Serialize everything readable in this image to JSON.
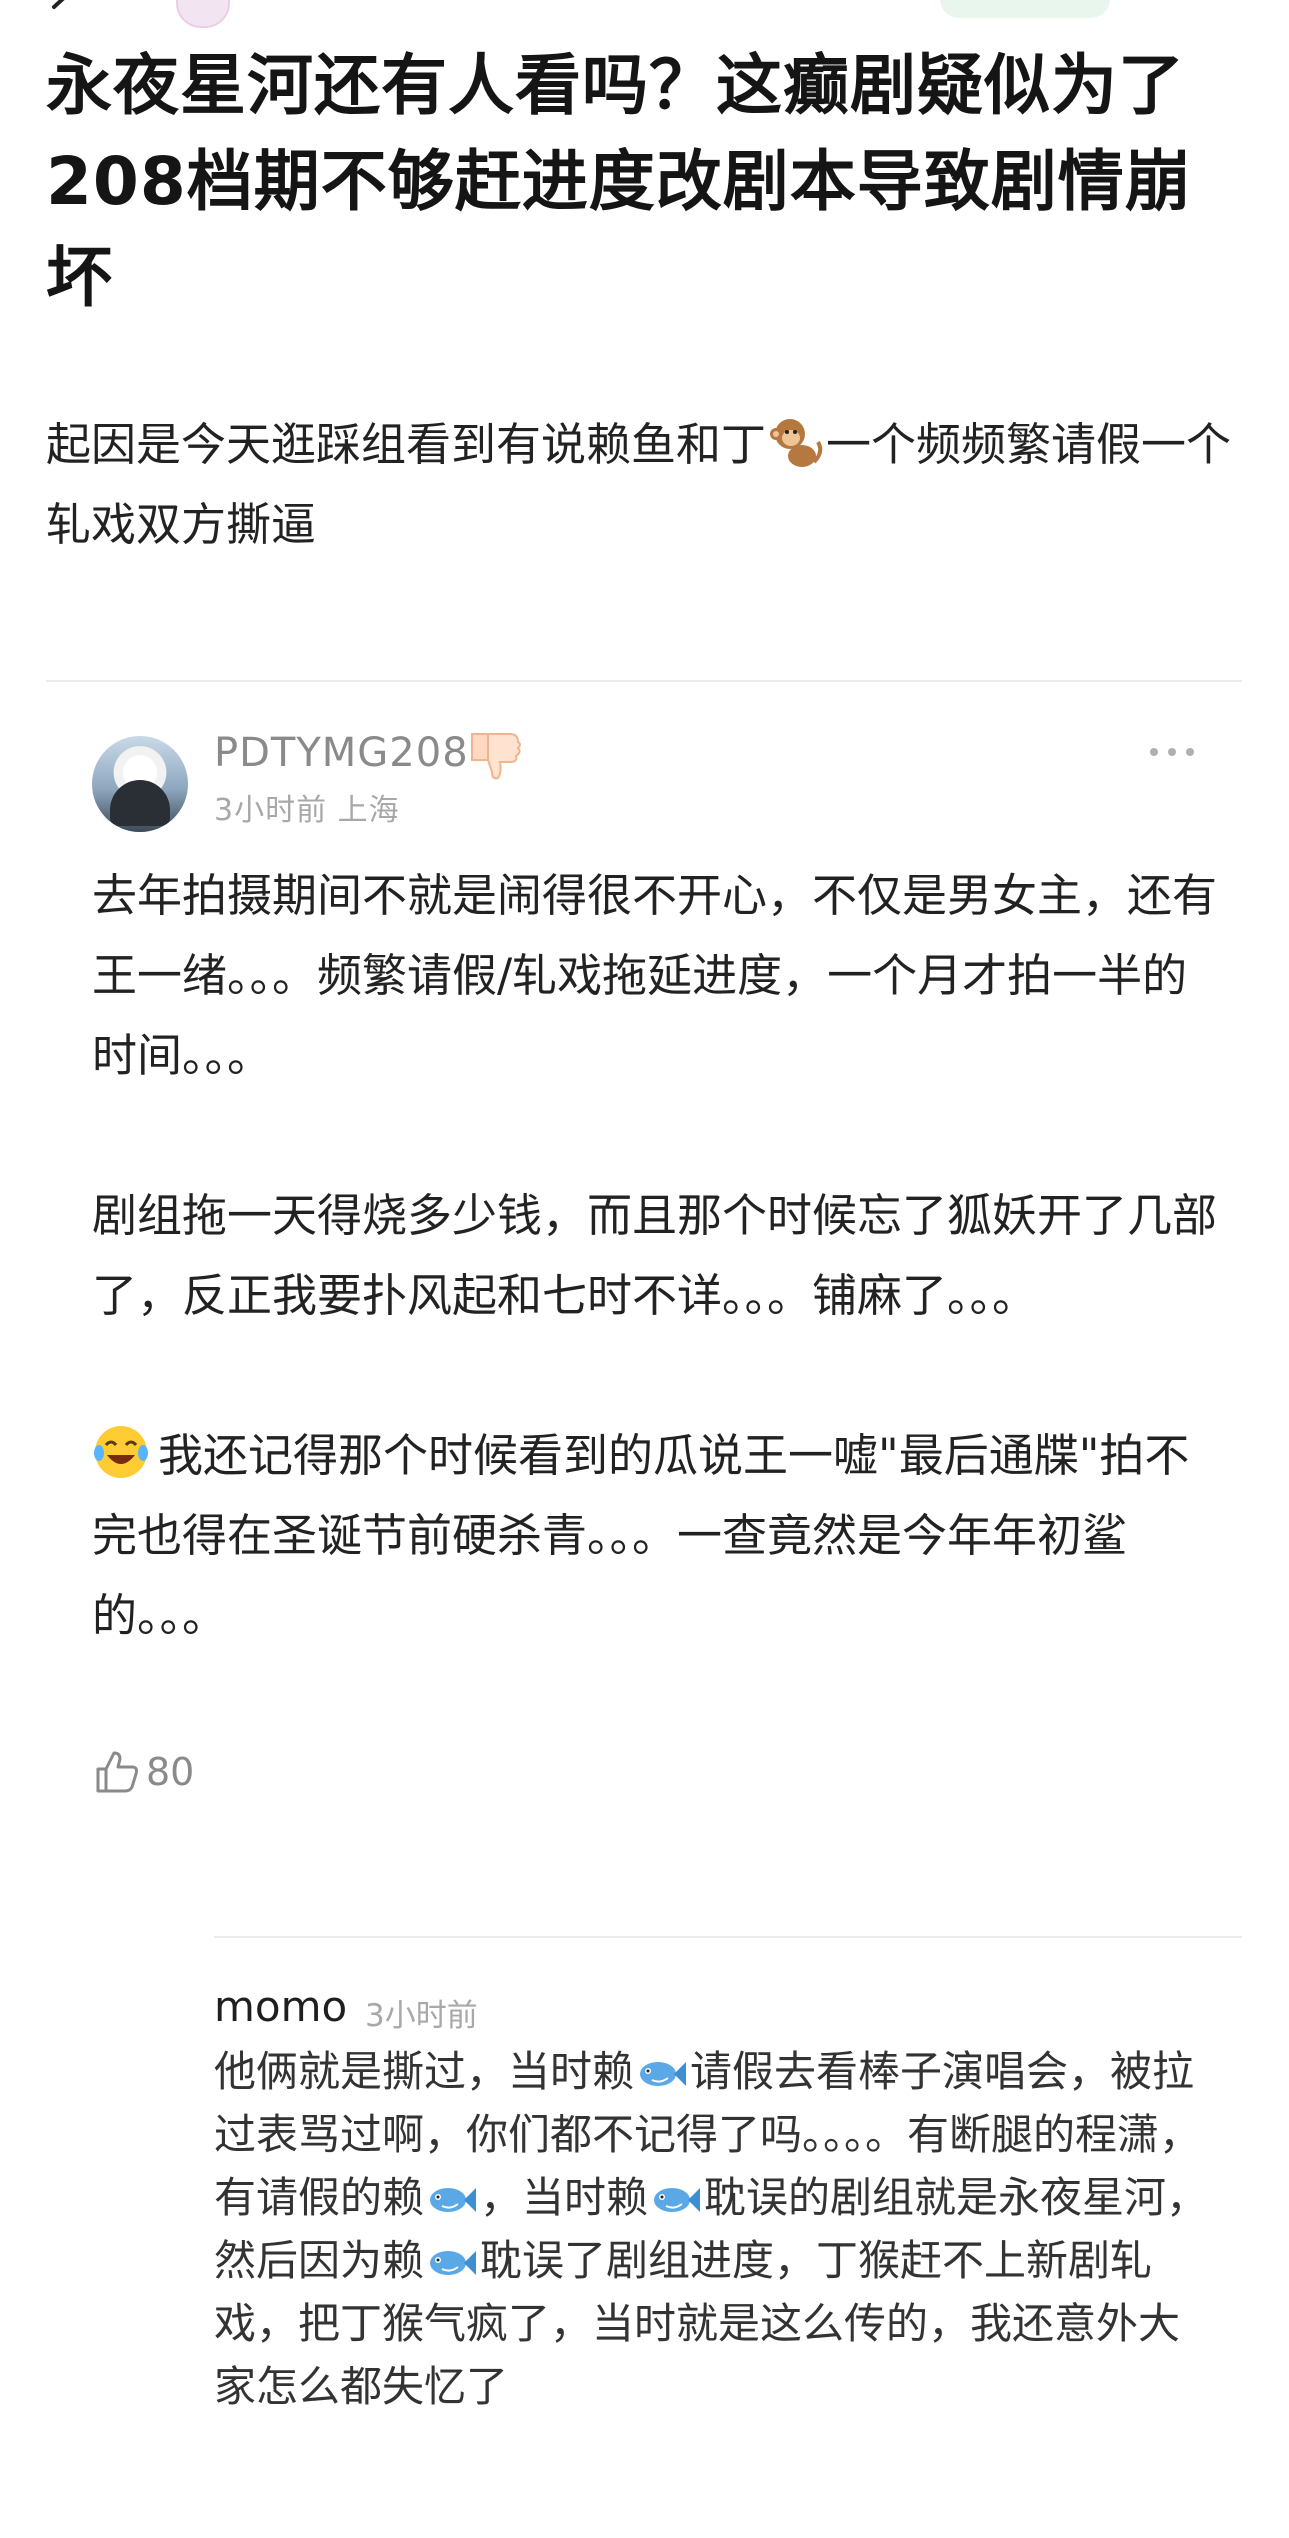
{
  "post": {
    "title": "永夜星河还有人看吗？这癫剧疑似为了208档期不够赶进度改剧本导致剧情崩坏",
    "body_part1": "起因是今天逛踩组看到有说赖鱼和丁",
    "body_part2": "一个频频繁请假一个轧戏双方撕逼"
  },
  "comment": {
    "username": "PDTYMG208",
    "meta": "3小时前 上海",
    "para1": "去年拍摄期间不就是闹得很不开心，不仅是男女主，还有王一绪。。。频繁请假/轧戏拖延进度，一个月才拍一半的时间。。。",
    "para2": "剧组拖一天得烧多少钱，而且那个时候忘了狐妖开了几部了，反正我要扑风起和七时不详。。。铺麻了。。。",
    "para3": "我还记得那个时候看到的瓜说王一嘘\"最后通牒\"拍不完也得在圣诞节前硬杀青。。。一查竟然是今年年初鲨的。。。",
    "likes": "80"
  },
  "reply": {
    "author": "momo",
    "time": "3小时前",
    "seg1": "他俩就是撕过，当时赖",
    "seg2": "请假去看棒子演唱会，被拉过表骂过啊，你们都不记得了吗。。。。有断腿的程潇，有请假的赖",
    "seg3": "，当时赖",
    "seg4": "耽误的剧组就是永夜星河，然后因为赖",
    "seg5": "耽误了剧组进度，丁猴赶不上新剧轧戏，把丁猴气疯了，当时就是这么传的，我还意外大家怎么都失忆了"
  },
  "icons": {
    "back": "back-chevron-icon",
    "badge": "thumbs-down-icon",
    "more": "more-dots-icon",
    "like": "thumbs-up-icon",
    "emoji_monkey": "monkey-emoji",
    "emoji_laugh": "laughing-tears-emoji",
    "emoji_fish": "fish-emoji"
  }
}
